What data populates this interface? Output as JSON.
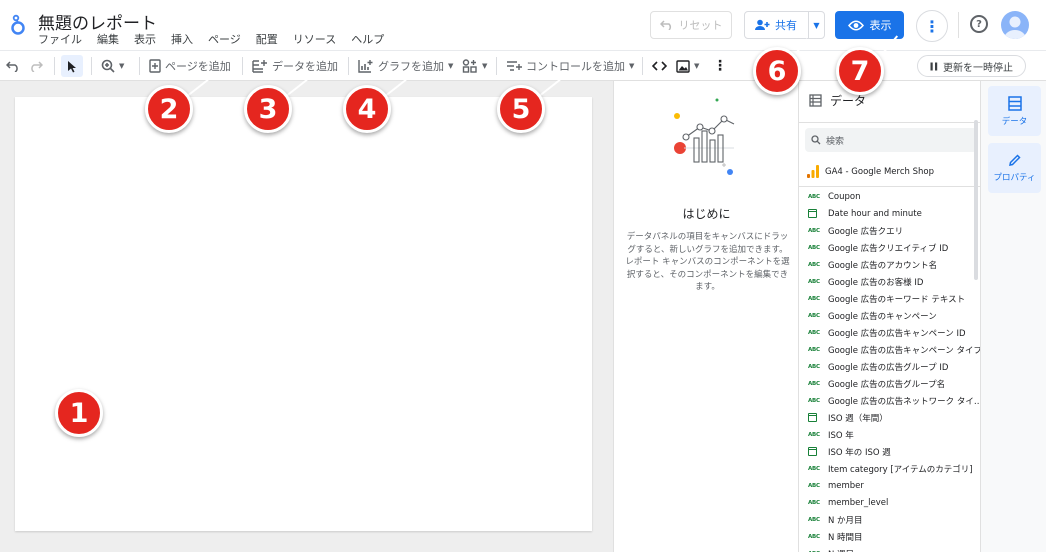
{
  "header": {
    "title": "無題のレポート",
    "menu": [
      "ファイル",
      "編集",
      "表示",
      "挿入",
      "ページ",
      "配置",
      "リソース",
      "ヘルプ"
    ],
    "reset_label": "リセット",
    "share_label": "共有",
    "view_label": "表示"
  },
  "toolbar": {
    "add_page": "ページを追加",
    "add_data": "データを追加",
    "add_chart": "グラフを追加",
    "add_control": "コントロールを追加",
    "pause_update": "更新を一時停止"
  },
  "start_panel": {
    "title": "はじめに",
    "text": "データパネルの項目をキャンバスにドラッグすると、新しいグラフを追加できます。レポート キャンバスのコンポーネントを選択すると、そのコンポーネントを編集できます。"
  },
  "data_panel": {
    "title": "データ",
    "search_placeholder": "検索",
    "source": "GA4 - Google Merch Shop",
    "fields": [
      {
        "type": "text",
        "name": "Coupon"
      },
      {
        "type": "date",
        "name": "Date hour and minute"
      },
      {
        "type": "text",
        "name": "Google 広告クエリ"
      },
      {
        "type": "text",
        "name": "Google 広告クリエイティブ ID"
      },
      {
        "type": "text",
        "name": "Google 広告のアカウント名"
      },
      {
        "type": "text",
        "name": "Google 広告のお客様 ID"
      },
      {
        "type": "text",
        "name": "Google 広告のキーワード テキスト"
      },
      {
        "type": "text",
        "name": "Google 広告のキャンペーン"
      },
      {
        "type": "text",
        "name": "Google 広告の広告キャンペーン ID"
      },
      {
        "type": "text",
        "name": "Google 広告の広告キャンペーン タイプ"
      },
      {
        "type": "text",
        "name": "Google 広告の広告グループ ID"
      },
      {
        "type": "text",
        "name": "Google 広告の広告グループ名"
      },
      {
        "type": "text",
        "name": "Google 広告の広告ネットワーク タイ…"
      },
      {
        "type": "date",
        "name": "ISO 週（年間）"
      },
      {
        "type": "text",
        "name": "ISO 年"
      },
      {
        "type": "date",
        "name": "ISO 年の ISO 週"
      },
      {
        "type": "text",
        "name": "Item category [アイテムのカテゴリ]"
      },
      {
        "type": "text",
        "name": "member"
      },
      {
        "type": "text",
        "name": "member_level"
      },
      {
        "type": "text",
        "name": "N か月目"
      },
      {
        "type": "text",
        "name": "N 時間目"
      },
      {
        "type": "text",
        "name": "N 週目"
      }
    ],
    "type_label_text": "ABC"
  },
  "rail": {
    "data_tab": "データ",
    "properties_tab": "プロパティ"
  },
  "annotations": [
    "1",
    "2",
    "3",
    "4",
    "5",
    "6",
    "7"
  ],
  "colors": {
    "accent": "#1a73e8",
    "badge": "#e5261f"
  }
}
